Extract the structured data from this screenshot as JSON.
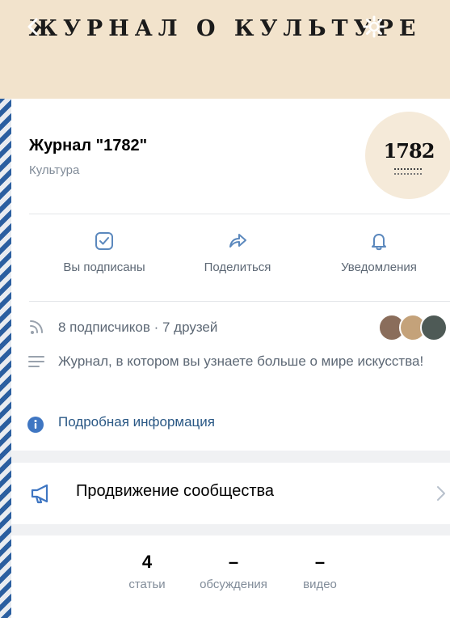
{
  "cover": {
    "title": "ЖУРНАЛ О КУЛЬТУРЕ",
    "background": "#f2e3cc"
  },
  "header": {
    "back_icon": "chevron-left-icon",
    "settings_icon": "gear-icon"
  },
  "community": {
    "name": "Журнал \"1782\"",
    "category": "Культура",
    "avatar_text": "1782"
  },
  "actions": [
    {
      "label": "Вы подписаны",
      "icon": "check-square-icon"
    },
    {
      "label": "Поделиться",
      "icon": "share-arrow-icon"
    },
    {
      "label": "Уведомления",
      "icon": "bell-icon"
    }
  ],
  "info": {
    "followers": "8 подписчиков · 7 друзей",
    "description": "Журнал, в котором вы узнаете больше о мире искусства!",
    "details_link": "Подробная информация"
  },
  "promo": {
    "label": "Продвижение сообщества",
    "icon": "megaphone-icon"
  },
  "stats": [
    {
      "value": "4",
      "label": "статьи"
    },
    {
      "value": "–",
      "label": "обсуждения"
    },
    {
      "value": "–",
      "label": "видео"
    }
  ],
  "colors": {
    "accent": "#2a5885",
    "icon": "#5b88bd",
    "muted": "#818c99",
    "info_dot": "#3f76c2"
  }
}
